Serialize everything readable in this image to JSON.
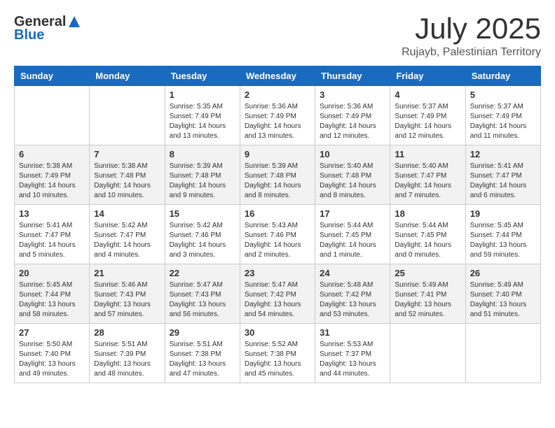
{
  "header": {
    "logo_general": "General",
    "logo_blue": "Blue",
    "month_title": "July 2025",
    "location": "Rujayb, Palestinian Territory"
  },
  "days_of_week": [
    "Sunday",
    "Monday",
    "Tuesday",
    "Wednesday",
    "Thursday",
    "Friday",
    "Saturday"
  ],
  "weeks": [
    [
      {
        "day": "",
        "detail": ""
      },
      {
        "day": "",
        "detail": ""
      },
      {
        "day": "1",
        "detail": "Sunrise: 5:35 AM\nSunset: 7:49 PM\nDaylight: 14 hours\nand 13 minutes."
      },
      {
        "day": "2",
        "detail": "Sunrise: 5:36 AM\nSunset: 7:49 PM\nDaylight: 14 hours\nand 13 minutes."
      },
      {
        "day": "3",
        "detail": "Sunrise: 5:36 AM\nSunset: 7:49 PM\nDaylight: 14 hours\nand 12 minutes."
      },
      {
        "day": "4",
        "detail": "Sunrise: 5:37 AM\nSunset: 7:49 PM\nDaylight: 14 hours\nand 12 minutes."
      },
      {
        "day": "5",
        "detail": "Sunrise: 5:37 AM\nSunset: 7:49 PM\nDaylight: 14 hours\nand 11 minutes."
      }
    ],
    [
      {
        "day": "6",
        "detail": "Sunrise: 5:38 AM\nSunset: 7:49 PM\nDaylight: 14 hours\nand 10 minutes."
      },
      {
        "day": "7",
        "detail": "Sunrise: 5:38 AM\nSunset: 7:48 PM\nDaylight: 14 hours\nand 10 minutes."
      },
      {
        "day": "8",
        "detail": "Sunrise: 5:39 AM\nSunset: 7:48 PM\nDaylight: 14 hours\nand 9 minutes."
      },
      {
        "day": "9",
        "detail": "Sunrise: 5:39 AM\nSunset: 7:48 PM\nDaylight: 14 hours\nand 8 minutes."
      },
      {
        "day": "10",
        "detail": "Sunrise: 5:40 AM\nSunset: 7:48 PM\nDaylight: 14 hours\nand 8 minutes."
      },
      {
        "day": "11",
        "detail": "Sunrise: 5:40 AM\nSunset: 7:47 PM\nDaylight: 14 hours\nand 7 minutes."
      },
      {
        "day": "12",
        "detail": "Sunrise: 5:41 AM\nSunset: 7:47 PM\nDaylight: 14 hours\nand 6 minutes."
      }
    ],
    [
      {
        "day": "13",
        "detail": "Sunrise: 5:41 AM\nSunset: 7:47 PM\nDaylight: 14 hours\nand 5 minutes."
      },
      {
        "day": "14",
        "detail": "Sunrise: 5:42 AM\nSunset: 7:47 PM\nDaylight: 14 hours\nand 4 minutes."
      },
      {
        "day": "15",
        "detail": "Sunrise: 5:42 AM\nSunset: 7:46 PM\nDaylight: 14 hours\nand 3 minutes."
      },
      {
        "day": "16",
        "detail": "Sunrise: 5:43 AM\nSunset: 7:46 PM\nDaylight: 14 hours\nand 2 minutes."
      },
      {
        "day": "17",
        "detail": "Sunrise: 5:44 AM\nSunset: 7:45 PM\nDaylight: 14 hours\nand 1 minute."
      },
      {
        "day": "18",
        "detail": "Sunrise: 5:44 AM\nSunset: 7:45 PM\nDaylight: 14 hours\nand 0 minutes."
      },
      {
        "day": "19",
        "detail": "Sunrise: 5:45 AM\nSunset: 7:44 PM\nDaylight: 13 hours\nand 59 minutes."
      }
    ],
    [
      {
        "day": "20",
        "detail": "Sunrise: 5:45 AM\nSunset: 7:44 PM\nDaylight: 13 hours\nand 58 minutes."
      },
      {
        "day": "21",
        "detail": "Sunrise: 5:46 AM\nSunset: 7:43 PM\nDaylight: 13 hours\nand 57 minutes."
      },
      {
        "day": "22",
        "detail": "Sunrise: 5:47 AM\nSunset: 7:43 PM\nDaylight: 13 hours\nand 56 minutes."
      },
      {
        "day": "23",
        "detail": "Sunrise: 5:47 AM\nSunset: 7:42 PM\nDaylight: 13 hours\nand 54 minutes."
      },
      {
        "day": "24",
        "detail": "Sunrise: 5:48 AM\nSunset: 7:42 PM\nDaylight: 13 hours\nand 53 minutes."
      },
      {
        "day": "25",
        "detail": "Sunrise: 5:49 AM\nSunset: 7:41 PM\nDaylight: 13 hours\nand 52 minutes."
      },
      {
        "day": "26",
        "detail": "Sunrise: 5:49 AM\nSunset: 7:40 PM\nDaylight: 13 hours\nand 51 minutes."
      }
    ],
    [
      {
        "day": "27",
        "detail": "Sunrise: 5:50 AM\nSunset: 7:40 PM\nDaylight: 13 hours\nand 49 minutes."
      },
      {
        "day": "28",
        "detail": "Sunrise: 5:51 AM\nSunset: 7:39 PM\nDaylight: 13 hours\nand 48 minutes."
      },
      {
        "day": "29",
        "detail": "Sunrise: 5:51 AM\nSunset: 7:38 PM\nDaylight: 13 hours\nand 47 minutes."
      },
      {
        "day": "30",
        "detail": "Sunrise: 5:52 AM\nSunset: 7:38 PM\nDaylight: 13 hours\nand 45 minutes."
      },
      {
        "day": "31",
        "detail": "Sunrise: 5:53 AM\nSunset: 7:37 PM\nDaylight: 13 hours\nand 44 minutes."
      },
      {
        "day": "",
        "detail": ""
      },
      {
        "day": "",
        "detail": ""
      }
    ]
  ]
}
